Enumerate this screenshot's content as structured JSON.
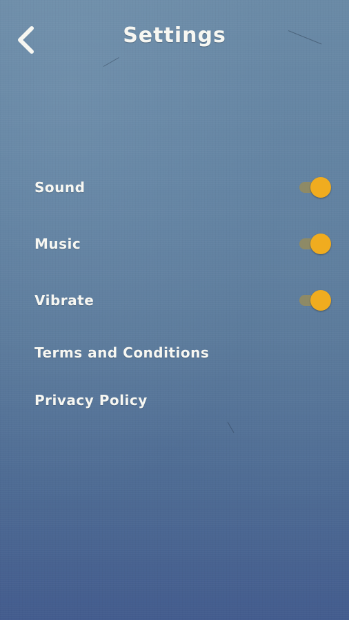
{
  "header": {
    "title": "Settings",
    "back_icon": "chevron-left-icon"
  },
  "settings": {
    "toggles": [
      {
        "label": "Sound",
        "enabled": true
      },
      {
        "label": "Music",
        "enabled": true
      },
      {
        "label": "Vibrate",
        "enabled": true
      }
    ],
    "links": [
      {
        "label": "Terms and Conditions"
      },
      {
        "label": "Privacy Policy"
      }
    ]
  },
  "colors": {
    "toggle_on_thumb": "#f0ac1f",
    "toggle_track": "#8e8a66",
    "text": "#f7f7f2",
    "background_top": "#6a8aa6",
    "background_bottom": "#435c8e"
  }
}
